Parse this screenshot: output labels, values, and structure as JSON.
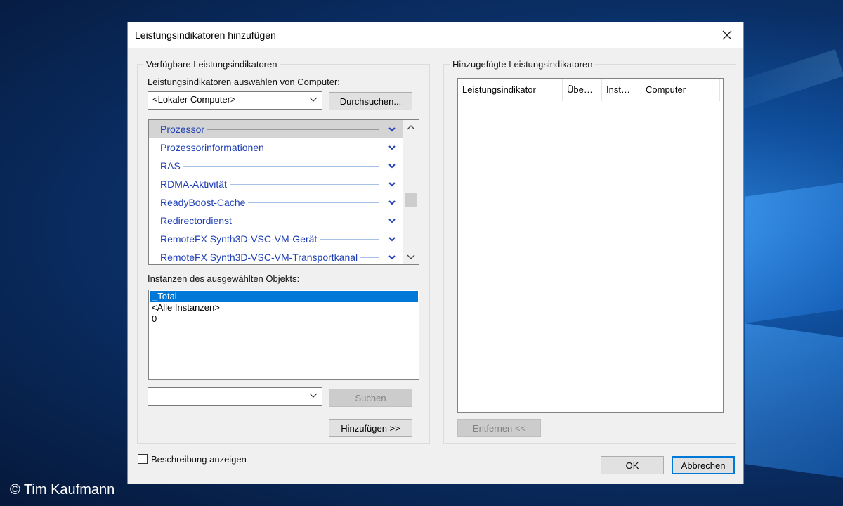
{
  "window": {
    "title": "Leistungsindikatoren hinzufügen",
    "close_icon": "close-icon"
  },
  "available": {
    "group_label": "Verfügbare Leistungsindikatoren",
    "computer_label": "Leistungsindikatoren auswählen von Computer:",
    "computer_value": "<Lokaler Computer>",
    "browse_button": "Durchsuchen...",
    "objects": [
      {
        "label": "Prozessor",
        "selected": true
      },
      {
        "label": "Prozessorinformationen",
        "selected": false
      },
      {
        "label": "RAS",
        "selected": false
      },
      {
        "label": "RDMA-Aktivität",
        "selected": false
      },
      {
        "label": "ReadyBoost-Cache",
        "selected": false
      },
      {
        "label": "Redirectordienst",
        "selected": false
      },
      {
        "label": "RemoteFX Synth3D-VSC-VM-Gerät",
        "selected": false
      },
      {
        "label": "RemoteFX Synth3D-VSC-VM-Transportkanal",
        "selected": false
      }
    ],
    "instances_label": "Instanzen des ausgewählten Objekts:",
    "instances": [
      {
        "label": "_Total",
        "selected": true
      },
      {
        "label": "<Alle Instanzen>",
        "selected": false
      },
      {
        "label": "0",
        "selected": false
      }
    ],
    "search_value": "",
    "search_button": "Suchen",
    "add_button": "Hinzufügen >>"
  },
  "added": {
    "group_label": "Hinzugefügte Leistungsindikatoren",
    "columns": [
      "Leistungsindikator",
      "Übe…",
      "Inst…",
      "Computer"
    ],
    "remove_button": "Entfernen <<"
  },
  "footer": {
    "show_description_label": "Beschreibung anzeigen",
    "show_description_checked": false,
    "ok_button": "OK",
    "cancel_button": "Abbrechen"
  },
  "credit": "© Tim Kaufmann",
  "colors": {
    "link_blue": "#1e3fb5",
    "selection_blue": "#0078d7",
    "dialog_bg": "#f0f0f0"
  }
}
